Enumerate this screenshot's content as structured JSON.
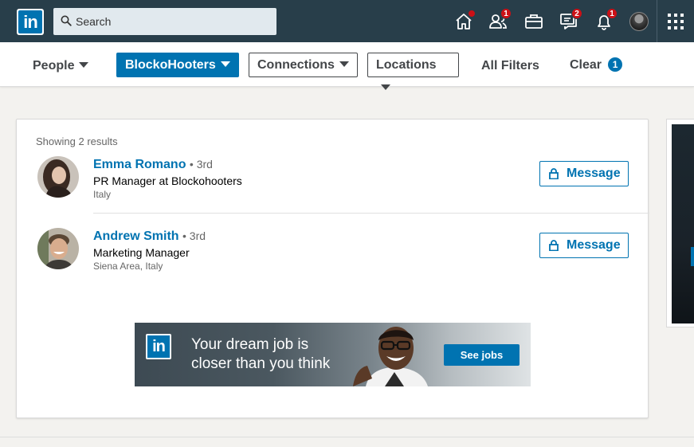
{
  "nav": {
    "logo_text": "in",
    "search_placeholder": "Search",
    "badges": {
      "home": "",
      "network": "1",
      "messaging": "2",
      "notifications": "1"
    }
  },
  "filters": {
    "people_label": "People",
    "company_label": "BlockoHooters",
    "connections_label": "Connections",
    "locations_label": "Locations",
    "all_filters_label": "All Filters",
    "clear_label": "Clear",
    "clear_count": "1"
  },
  "results": {
    "showing_text": "Showing 2 results",
    "items": [
      {
        "name": "Emma Romano",
        "degree": "• 3rd",
        "headline": "PR Manager at Blockohooters",
        "location": "Italy",
        "action_label": "Message"
      },
      {
        "name": "Andrew Smith",
        "degree": "• 3rd",
        "headline": "Marketing Manager",
        "location": "Siena Area, Italy",
        "action_label": "Message"
      }
    ]
  },
  "ad": {
    "logo_text": "in",
    "line1": "Your dream job is",
    "line2": "closer than you think",
    "cta": "See jobs"
  },
  "colors": {
    "nav_bg": "#283e4a",
    "brand_blue": "#0073b1",
    "badge_red": "#cc1016"
  }
}
